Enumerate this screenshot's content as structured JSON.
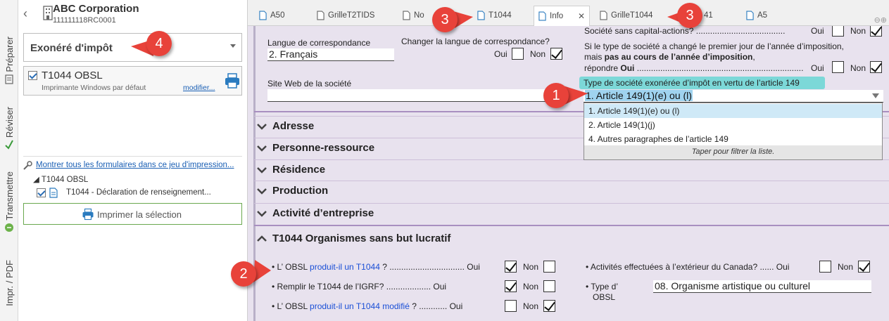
{
  "rail": {
    "items": [
      {
        "label": "Préparer",
        "icon": "form-icon"
      },
      {
        "label": "Réviser",
        "icon": "checkmark-icon"
      },
      {
        "label": "Transmettre",
        "icon": "send-icon"
      },
      {
        "label": "Impr. / PDF",
        "icon": "pdf-icon"
      }
    ]
  },
  "company": {
    "name": "ABC Corporation",
    "number": "111111118RC0001"
  },
  "print_set": {
    "selected": "Exonéré d'impôt"
  },
  "printer_card": {
    "title": "T1044 OBSL",
    "subtitle": "Imprimante Windows par défaut",
    "link": "modifier..."
  },
  "forms": {
    "show_all_link": "Montrer tous les formulaires dans ce jeu d'impression...",
    "tree_root": "T1044 OBSL",
    "tree_item": "T1044 - Déclaration de renseignement..."
  },
  "print_button": "Imprimer la sélection",
  "tabs": [
    {
      "label": "A50"
    },
    {
      "label": "GrilleT2TIDS"
    },
    {
      "label": "No"
    },
    {
      "label": "T1044"
    },
    {
      "label": "Info",
      "active": true
    },
    {
      "label": "GrilleT1044"
    },
    {
      "label": "41"
    },
    {
      "label": "A5"
    }
  ],
  "form": {
    "lang_label": "Langue de correspondance",
    "lang_value": "2. Français",
    "change_lang_label": "Changer la langue de correspondance?",
    "oui": "Oui",
    "non": "Non",
    "website_label": "Site Web de la société",
    "no_share_label": "Société sans capital-actions? ......................................",
    "type_changed_l1": "Si le type de société a changé le premier jour de l’année d’imposition,",
    "type_changed_l2a": "mais ",
    "type_changed_l2b": "pas au cours de l’année d’imposition",
    "type_changed_l2c": ",",
    "type_changed_l3a": "répondre ",
    "type_changed_l3b": "Oui",
    "type_changed_l3c": " .......................................................................",
    "exempt_type_label": "Type de société exonérée d’impôt en vertu de l’article 149",
    "exempt_type_value": "1. Article 149(1)(e) ou (l)"
  },
  "dropdown": {
    "options": [
      "1. Article 149(1)(e) ou (l)",
      "2. Article 149(1)(j)",
      "4. Autres paragraphes de l’article 149"
    ],
    "hint": "Taper pour filtrer la liste."
  },
  "sections": [
    "Adresse",
    "Personne-ressource",
    "Résidence",
    "Production",
    "Activité d’entreprise"
  ],
  "t1044_section": {
    "title": "T1044 Organismes sans but lucratif",
    "q1_a": "L’ OBSL ",
    "q1_b": "produit-il un T1044",
    "q1_c": " ? ................................ Oui",
    "q2": "Remplir le T1044 de l’IGRF? ................... Oui",
    "q3_a": "L’ OBSL ",
    "q3_b": "produit-il un T1044 modifié",
    "q3_c": " ? ............ Oui",
    "q4": "Activités effectuées à l’extérieur du Canada? ...... Oui",
    "q5_l1": "Type d’",
    "q5_l2": "OBSL",
    "q5_value": "08. Organisme artistique ou culturel",
    "non": "Non"
  },
  "callouts": [
    "1",
    "2",
    "3",
    "3",
    "4"
  ]
}
